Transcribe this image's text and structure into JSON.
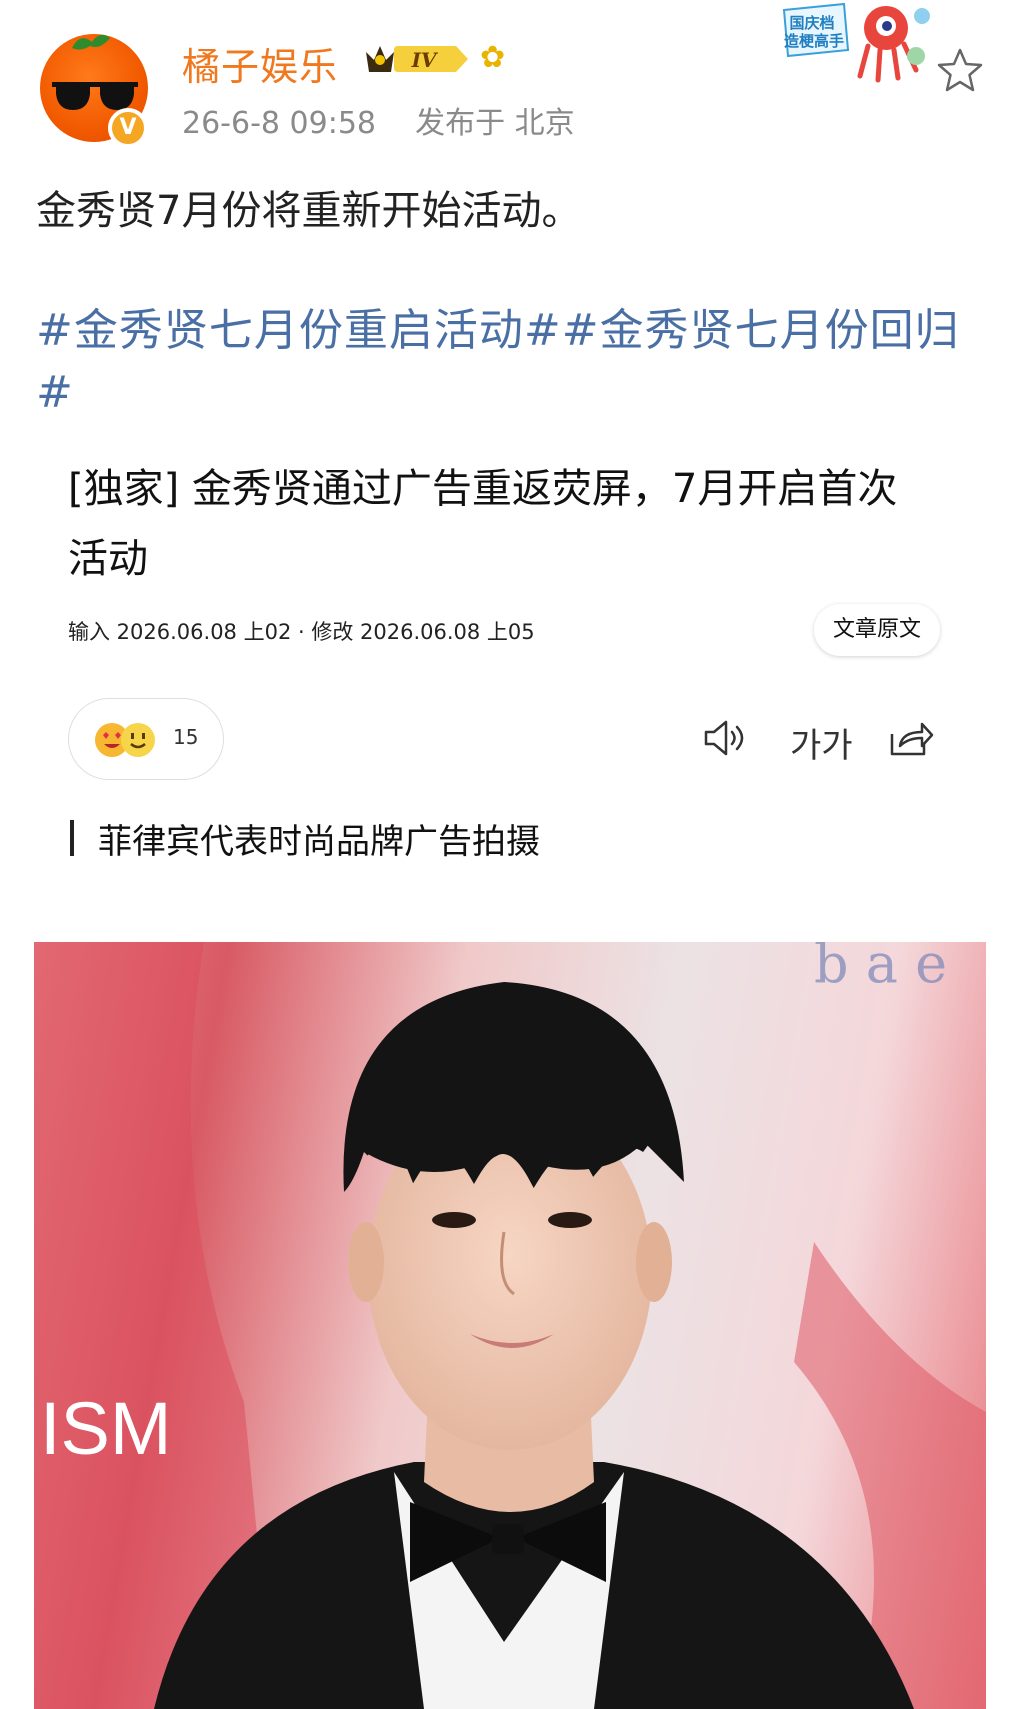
{
  "post": {
    "username": "橘子娱乐",
    "vip_level": "IV",
    "date": "26-6-8 09:58",
    "location": "发布于 北京",
    "badge_text_line1": "国庆档",
    "badge_text_line2": "造梗高手",
    "verified_mark": "V",
    "body": "金秀贤7月份将重新开始活动。",
    "hashtags": "#金秀贤七月份重启活动##金秀贤七月份回归#"
  },
  "article": {
    "title": "[独家] 金秀贤通过广告重返荧屏，7月开启首次活动",
    "meta": "输入 2026.06.08 上02 · 修改 2026.06.08 上05",
    "original_button": "文章原文",
    "reaction_count": "15",
    "font_size_label": "가가",
    "caption": "菲律宾代表时尚品牌广告拍摄"
  },
  "photo": {
    "watermark": "ISM",
    "background_letters": "b a e"
  },
  "icons": [
    "star-icon",
    "speaker-icon",
    "font-size-icon",
    "share-icon"
  ],
  "colors": {
    "username": "#f0781e",
    "hashtag": "#4a6fa5",
    "verified": "#f5a623"
  }
}
